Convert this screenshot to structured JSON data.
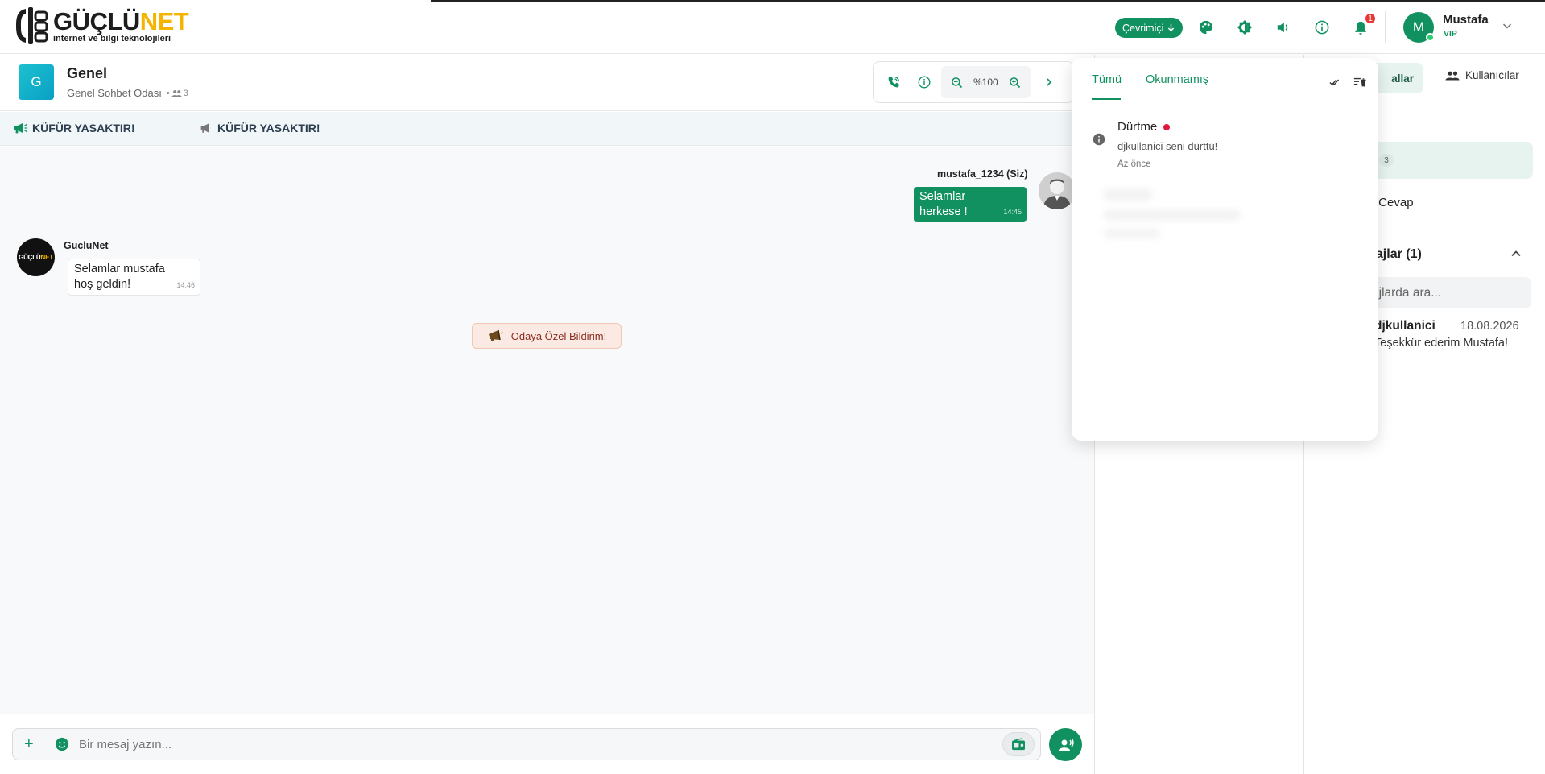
{
  "app": {
    "logo_title_main": "GÜÇLÜ",
    "logo_title_accent": "NET",
    "logo_subtitle": "internet ve bilgi teknolojileri",
    "brand_color": "#129160",
    "accent_color": "#f5b400"
  },
  "topbar": {
    "status_label": "Çevrimiçi",
    "notification_count": "1",
    "icons": [
      "palette-icon",
      "theme-contrast-icon",
      "volume-icon",
      "info-icon",
      "bell-icon"
    ],
    "user": {
      "initial": "M",
      "name": "Mustafa",
      "role": "VIP"
    }
  },
  "room": {
    "avatar_initial": "G",
    "title": "Genel",
    "subtitle": "Genel Sohbet Odası",
    "member_count": "3",
    "zoom_level": "%100"
  },
  "announcements": [
    {
      "text": "KÜFÜR YASAKTIR!"
    },
    {
      "text": "KÜFÜR YASAKTIR!"
    }
  ],
  "messages": [
    {
      "sender": "mustafa_1234 (Siz)",
      "text_line1": "Selamlar",
      "text_line2": "herkese !",
      "time": "14:45",
      "own": true
    },
    {
      "sender": "GucluNet",
      "text_line1": "Selamlar mustafa",
      "text_line2": "hoş geldin!",
      "time": "14:46",
      "own": false
    }
  ],
  "system_note": "Odaya Özel Bildirim!",
  "composer": {
    "placeholder": "Bir mesaj yazın..."
  },
  "right_panel": {
    "tab_rooms_partial": "allar",
    "tab_users": "Kullanıcılar",
    "selected_room_badge": "3",
    "qa_link_partial": "& Cevap",
    "dm_section_partial": "sajlar (1)",
    "dm_search_partial": "ajlarda ara...",
    "dm_items": [
      {
        "name": "djkullanici",
        "date": "18.08.2026",
        "preview_partial": "Teşekkür ederim Mustafa!"
      }
    ]
  },
  "notifications": {
    "tab_all": "Tümü",
    "tab_unread": "Okunmamış",
    "items": [
      {
        "title": "Dürtme",
        "description": "djkullanici seni dürttü!",
        "time": "Az önce",
        "unread": true
      }
    ]
  }
}
